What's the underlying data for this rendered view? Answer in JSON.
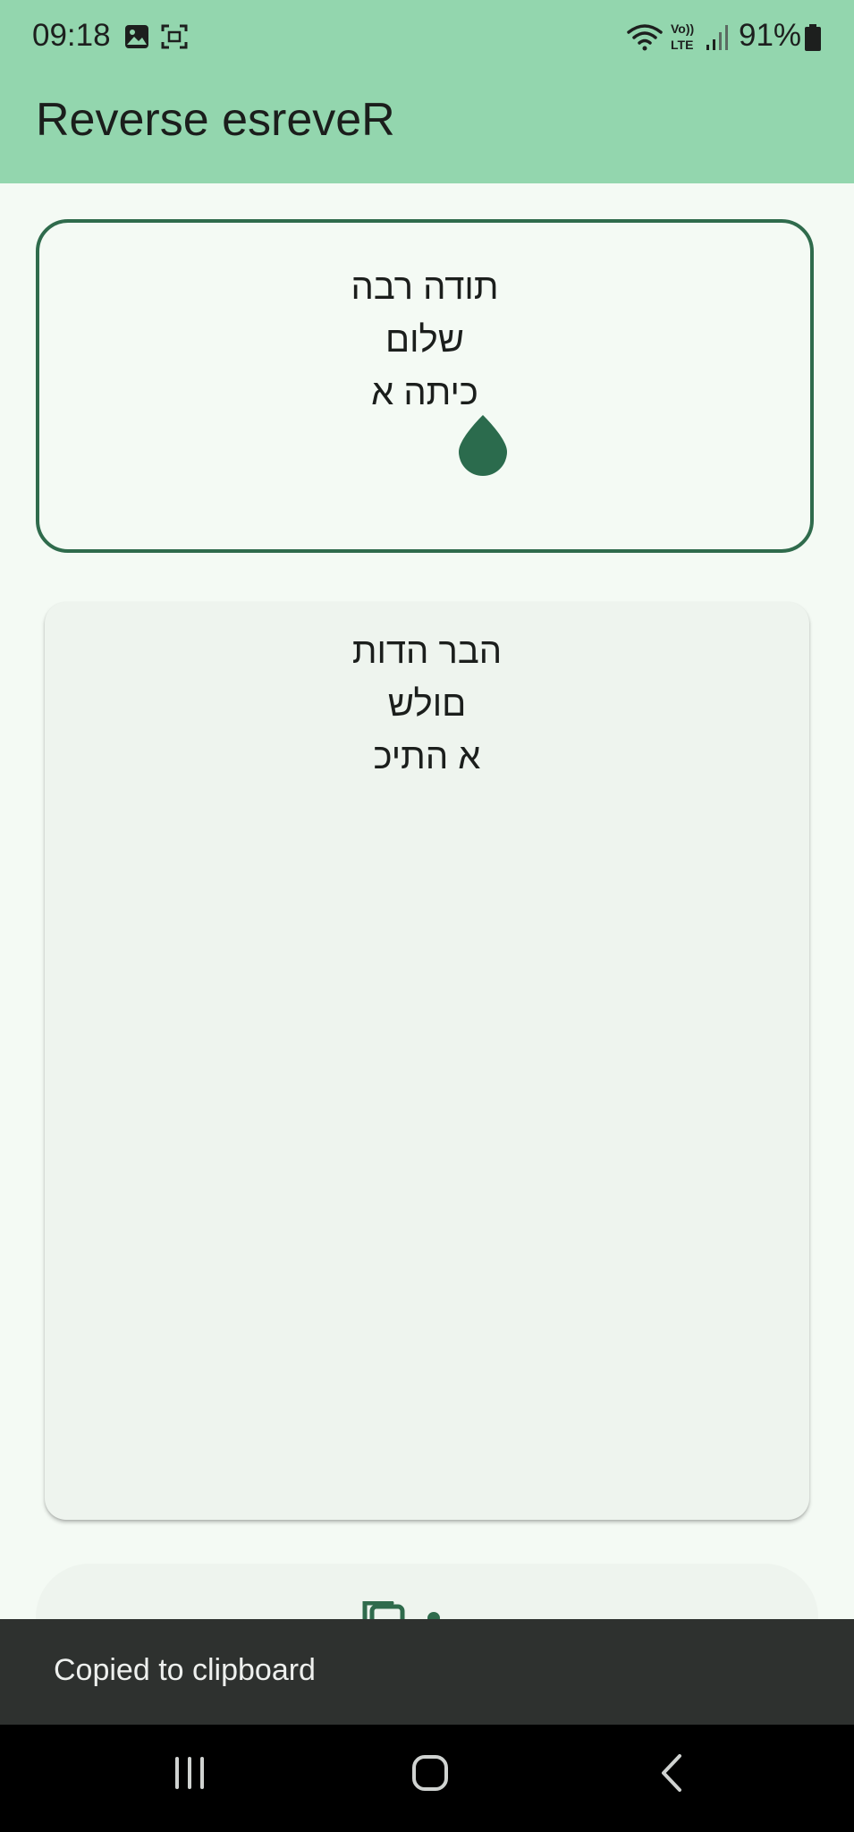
{
  "status_bar": {
    "time": "09:18",
    "battery": "91%",
    "icons": [
      "gallery-icon",
      "screen-capture-icon",
      "wifi-icon",
      "volte-icon",
      "signal-icon",
      "battery-icon"
    ]
  },
  "app_bar": {
    "title": "Reverse esreveR"
  },
  "input": {
    "lines": [
      "תודה רבה",
      "שלום",
      "כיתה א"
    ],
    "icon": "water-drop-icon"
  },
  "output": {
    "lines": [
      "הבר הדות",
      "םולש",
      "א התיכ"
    ]
  },
  "copy_button": {
    "icon": "copy-icon"
  },
  "snackbar": {
    "message": "Copied to clipboard"
  },
  "nav_bar": {
    "buttons": [
      "recents-button",
      "home-button",
      "back-button"
    ]
  },
  "colors": {
    "app_bar": "#93d6ae",
    "background": "#f4faf4",
    "primary": "#2f6b4c",
    "card": "#eef4ee",
    "snackbar": "#2e312f"
  }
}
